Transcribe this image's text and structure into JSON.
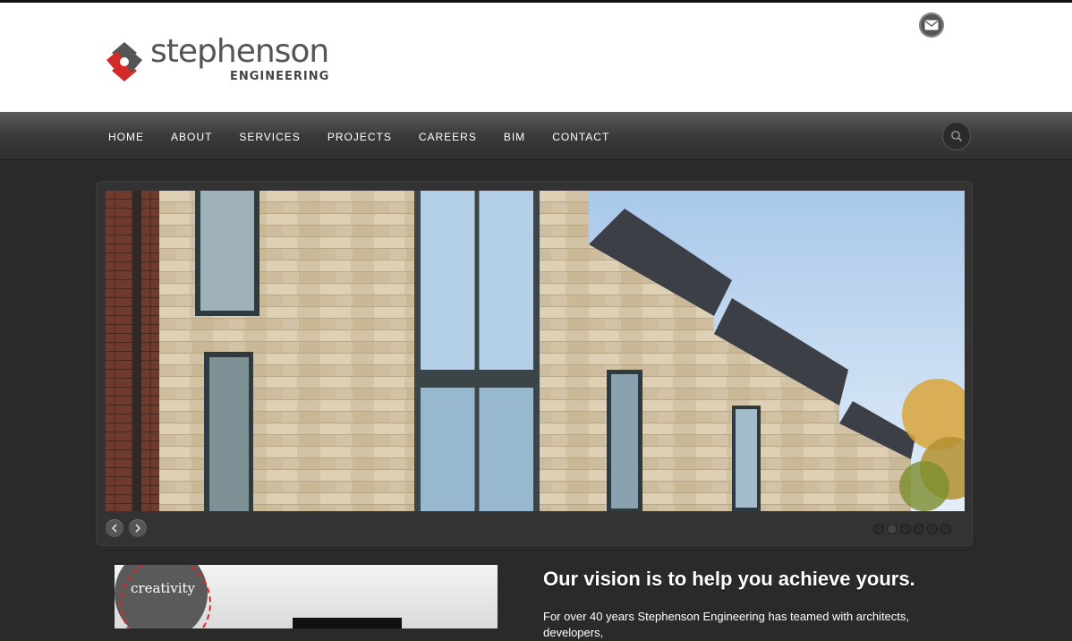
{
  "header": {
    "logo_name": "stephenson",
    "logo_sub": "ENGINEERING"
  },
  "nav": {
    "items": [
      {
        "label": "HOME"
      },
      {
        "label": "ABOUT"
      },
      {
        "label": "SERVICES"
      },
      {
        "label": "PROJECTS"
      },
      {
        "label": "CAREERS"
      },
      {
        "label": "BIM"
      },
      {
        "label": "CONTACT"
      }
    ]
  },
  "icons": {
    "mail": "email-icon",
    "search": "search-icon",
    "prev": "chevron-left-icon",
    "next": "chevron-right-icon"
  },
  "slider": {
    "slide_count": 6,
    "active_index": 1
  },
  "feature": {
    "badge_text": "creativity"
  },
  "content": {
    "headline": "Our vision is to help you achieve yours.",
    "intro": "For over 40 years Stephenson Engineering has teamed with architects, developers,"
  },
  "colors": {
    "brand_red": "#d42a2a",
    "brand_gray": "#555555",
    "nav_bg": "#3a3a3a",
    "page_bg": "#2a2a2a"
  }
}
